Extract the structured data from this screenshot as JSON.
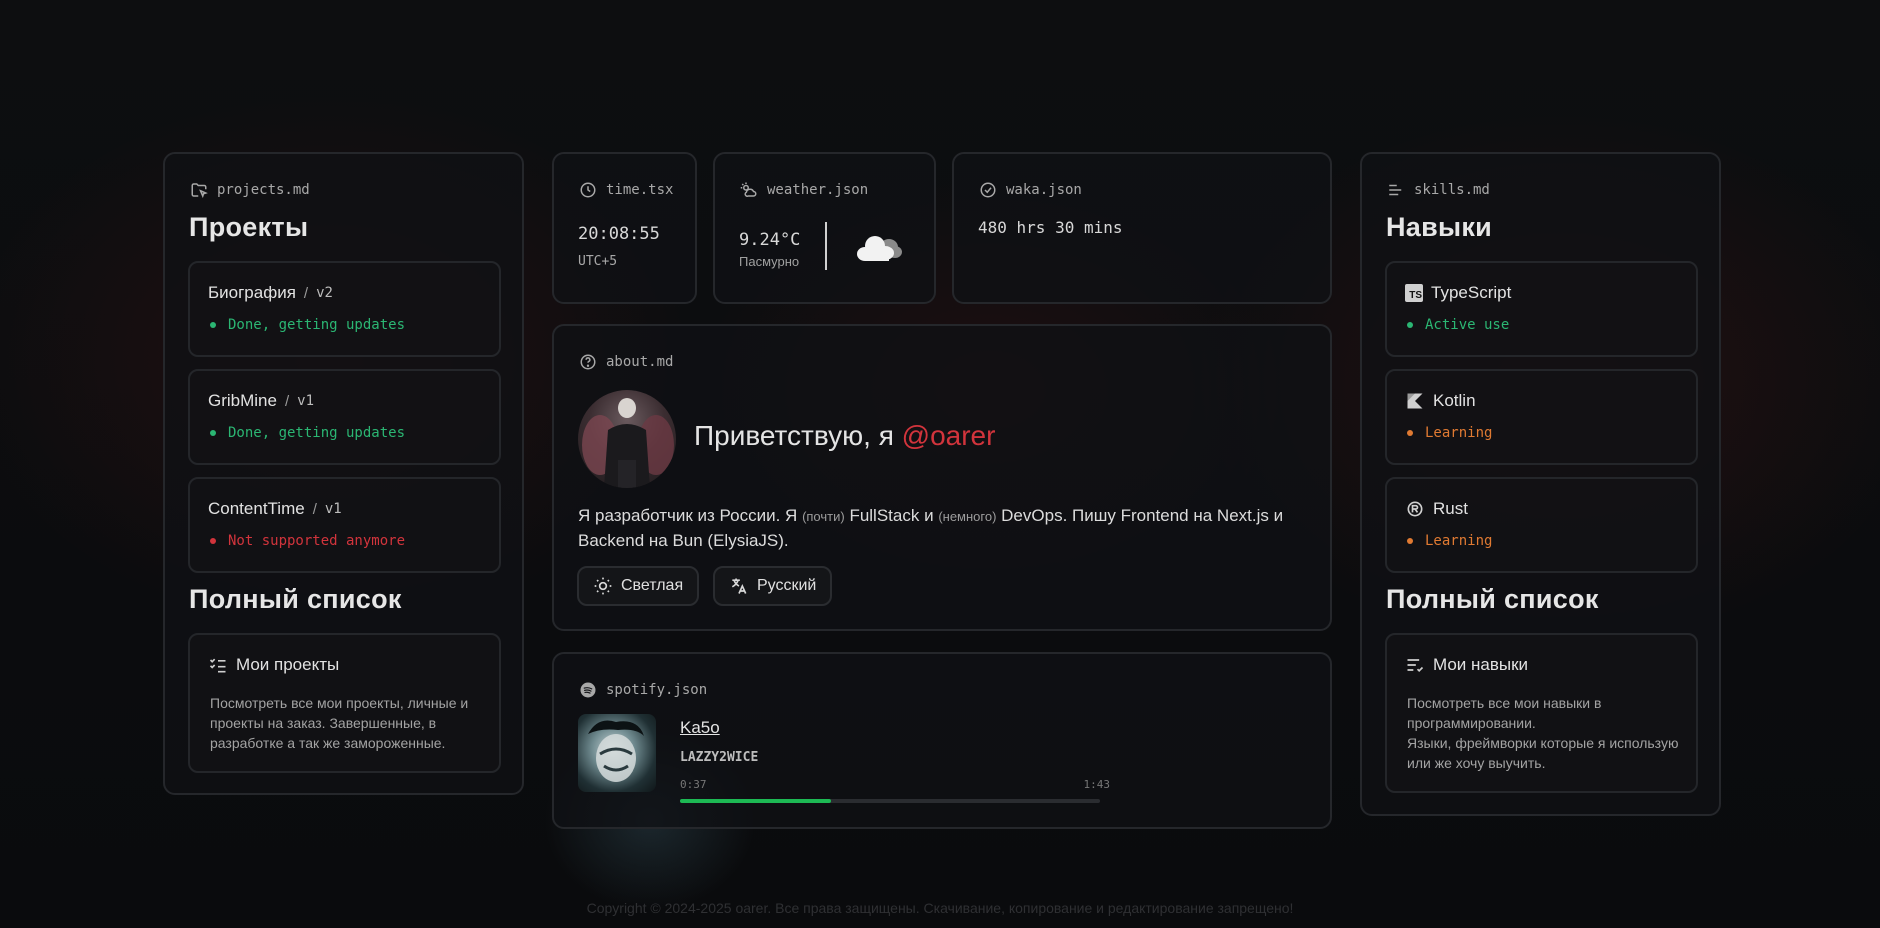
{
  "projects": {
    "file": "projects.md",
    "heading": "Проекты",
    "items": [
      {
        "title": "Биография",
        "version": "v2",
        "status": "Done, getting updates"
      },
      {
        "title": "GribMine",
        "version": "v1",
        "status": "Done, getting updates"
      },
      {
        "title": "ContentTime",
        "version": "v1",
        "status": "Not supported anymore"
      }
    ],
    "full_heading": "Полный список",
    "full_card": {
      "title": "Мои проекты",
      "description": "Посмотреть все мои проекты, личные и проекты на заказ. Завершенные, в разработке а так же замороженные."
    }
  },
  "time": {
    "file": "time.tsx",
    "value": "20:08:55",
    "zone": "UTC+5"
  },
  "weather": {
    "file": "weather.json",
    "temp": "9.24°C",
    "condition": "Пасмурно"
  },
  "waka": {
    "file": "waka.json",
    "value": "480 hrs 30 mins"
  },
  "about": {
    "file": "about.md",
    "greeting": "Приветствую, я",
    "handle": "@oarer",
    "bio_1": "Я разработчик из России. Я",
    "bio_note_1": "(почти)",
    "bio_2": "FullStack и",
    "bio_note_2": "(немного)",
    "bio_3": "DevOps. Пишу Frontend на Next.js и Backend на Bun (ElysiaJS).",
    "theme_button": "Светлая",
    "lang_button": "Русский"
  },
  "spotify": {
    "file": "spotify.json",
    "track": "Ka5o",
    "artist": "LAZZY2WICE",
    "elapsed": "0:37",
    "duration": "1:43",
    "progress": 0.36
  },
  "skills": {
    "file": "skills.md",
    "heading": "Навыки",
    "items": [
      {
        "title": "TypeScript",
        "status": "Active use"
      },
      {
        "title": "Kotlin",
        "status": "Learning"
      },
      {
        "title": "Rust",
        "status": "Learning"
      }
    ],
    "full_heading": "Полный список",
    "full_card": {
      "title": "Мои навыки",
      "description_1": "Посмотреть все мои навыки в программировании.",
      "description_2": "Языки, фреймворки которые я использую или же хочу выучить."
    }
  },
  "footer": "Copyright © 2024-2025 oarer. Все права защищены. Скачивание, копирование и редактирование запрещено!",
  "colors": {
    "accent": "#d2343c",
    "green": "#2bb673",
    "orange": "#e07a32",
    "spotify": "#1db954"
  }
}
